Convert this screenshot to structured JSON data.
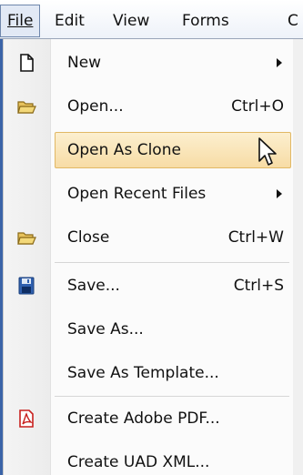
{
  "menubar": {
    "items": [
      {
        "label": "File",
        "active": true
      },
      {
        "label": "Edit"
      },
      {
        "label": "View"
      },
      {
        "label": "Forms"
      },
      {
        "label": "C"
      }
    ]
  },
  "menu": {
    "items": [
      {
        "label": "New",
        "mnemonic": "N",
        "icon": "new-document-icon",
        "submenu": true
      },
      {
        "label": "Open...",
        "mnemonic": "O",
        "shortcut": "Ctrl+O",
        "icon": "open-folder-icon"
      },
      {
        "label": "Open As Clone",
        "mnemonic": "l",
        "highlighted": true
      },
      {
        "label": "Open Recent Files",
        "mnemonic": "R",
        "submenu": true
      },
      {
        "label": "Close",
        "mnemonic": "C",
        "shortcut": "Ctrl+W",
        "icon": "close-folder-icon"
      },
      {
        "label": "Save...",
        "mnemonic": "v",
        "shortcut": "Ctrl+S",
        "icon": "save-disk-icon"
      },
      {
        "label": "Save As...",
        "mnemonic": "A"
      },
      {
        "label": "Save As Template...",
        "mnemonic": "T"
      },
      {
        "label": "Create Adobe PDF...",
        "mnemonic": "b",
        "icon": "adobe-pdf-icon"
      },
      {
        "label": "Create UAD XML...",
        "mnemonic": "U"
      }
    ]
  },
  "colors": {
    "highlight_fill": "#f7dca5",
    "highlight_border": "#e1b865",
    "accent_blue": "#3b64a8",
    "pdf_red": "#c8201e"
  }
}
